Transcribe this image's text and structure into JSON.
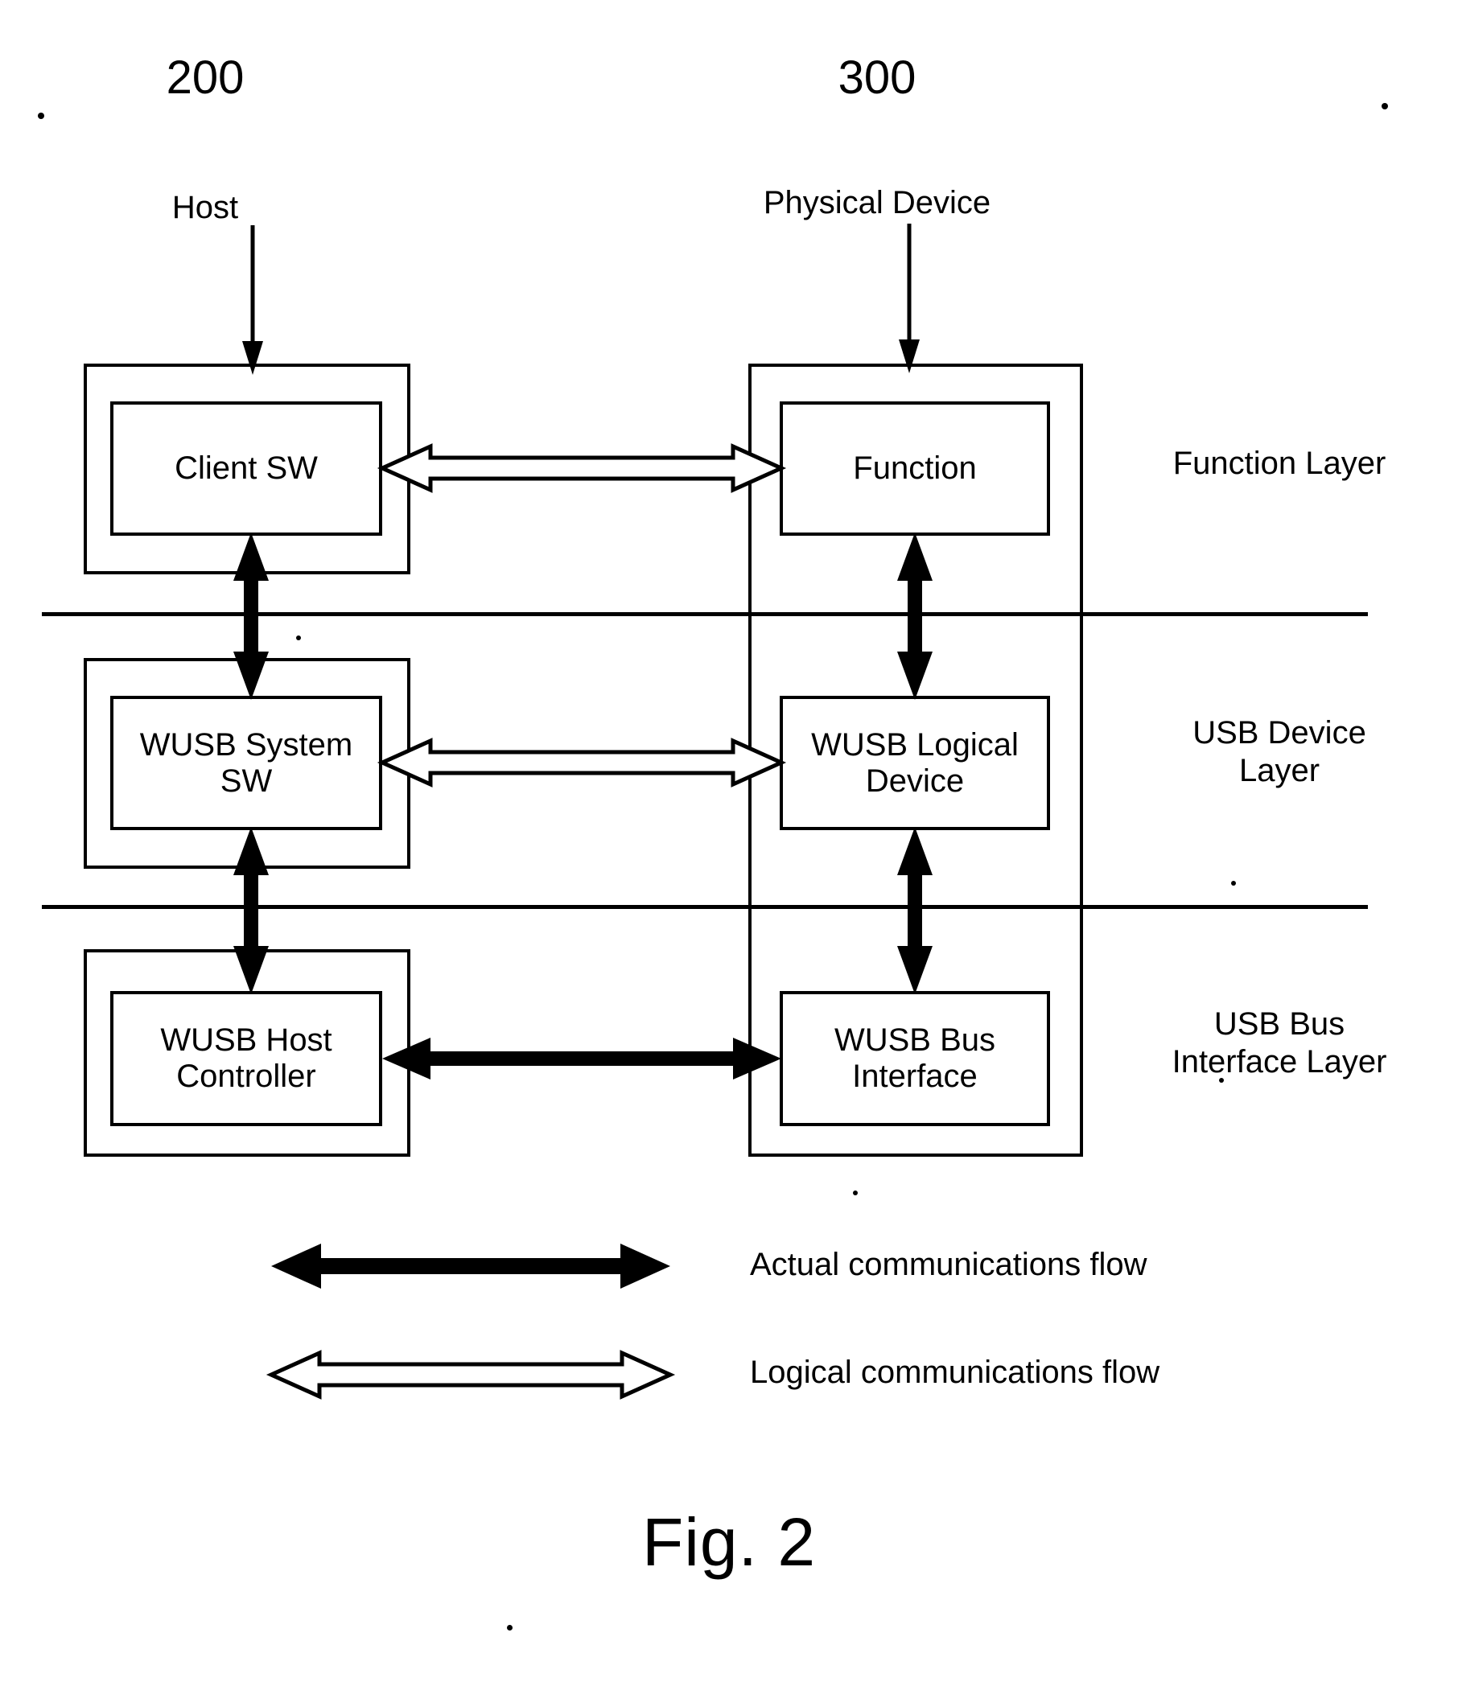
{
  "figure": {
    "caption": "Fig. 2",
    "reference_numerals": [
      {
        "id": "host-ref",
        "value": "200"
      },
      {
        "id": "device-ref",
        "value": "300"
      }
    ],
    "top_labels": [
      {
        "id": "host-label",
        "value": "Host"
      },
      {
        "id": "device-label",
        "value": "Physical Device"
      }
    ],
    "host_blocks": [
      {
        "id": "client-sw",
        "label": "Client SW"
      },
      {
        "id": "wusb-system-sw",
        "label": "WUSB System\nSW"
      },
      {
        "id": "wusb-host-controller",
        "label": "WUSB Host\nController"
      }
    ],
    "device_blocks": [
      {
        "id": "function",
        "label": "Function"
      },
      {
        "id": "wusb-logical-device",
        "label": "WUSB Logical\nDevice"
      },
      {
        "id": "wusb-bus-interface",
        "label": "WUSB Bus\nInterface"
      }
    ],
    "layer_captions": [
      {
        "id": "function-layer",
        "label": "Function Layer"
      },
      {
        "id": "usb-device-layer",
        "label": "USB Device\nLayer"
      },
      {
        "id": "usb-bus-interface-layer",
        "label": "USB Bus\nInterface Layer"
      }
    ],
    "legend": [
      {
        "id": "actual-flow",
        "label": "Actual communications flow",
        "style": "solid-filled-double-arrow"
      },
      {
        "id": "logical-flow",
        "label": "Logical communications flow",
        "style": "hollow-outline-double-arrow"
      }
    ],
    "colors": {
      "line": "#000000",
      "background": "#ffffff",
      "fill": "#ffffff"
    }
  }
}
